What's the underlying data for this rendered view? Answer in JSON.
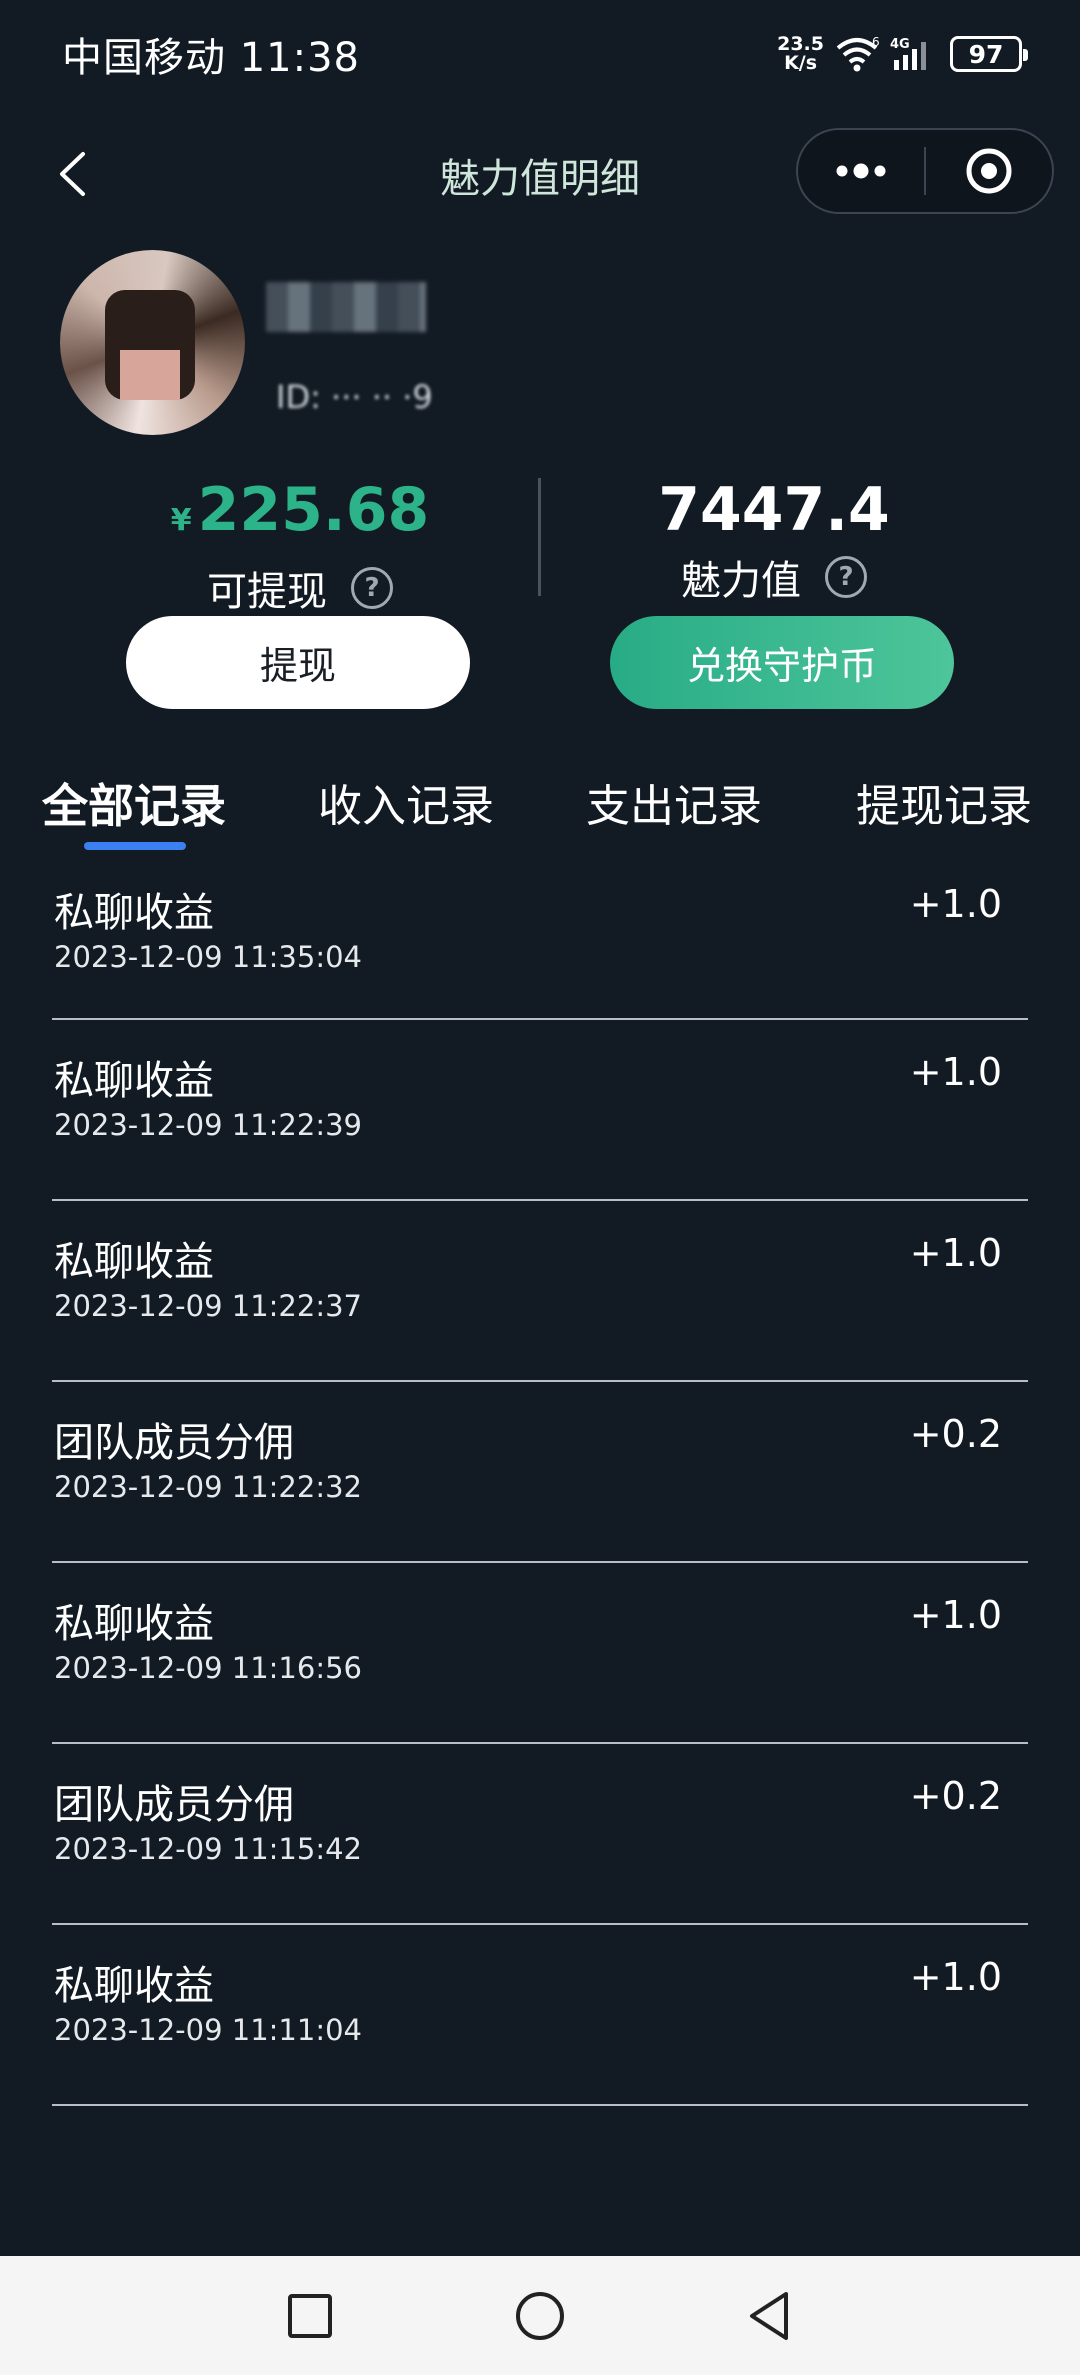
{
  "status_bar": {
    "carrier_time": "中国移动 11:38",
    "net_speed_value": "23.5",
    "net_speed_unit": "K/s",
    "wifi_label": "6",
    "signal_label": "4G",
    "battery": "97"
  },
  "nav": {
    "title": "魅力值明细"
  },
  "profile": {
    "id_label": "ID: ··· ·· ·9"
  },
  "stats": {
    "withdrawable_currency": "¥",
    "withdrawable_value": "225.68",
    "withdrawable_label": "可提现",
    "charm_value": "7447.4",
    "charm_label": "魅力值",
    "help_glyph": "?"
  },
  "buttons": {
    "withdraw": "提现",
    "exchange": "兑换守护币"
  },
  "tabs": [
    {
      "label": "全部记录",
      "active": true
    },
    {
      "label": "收入记录",
      "active": false
    },
    {
      "label": "支出记录",
      "active": false
    },
    {
      "label": "提现记录",
      "active": false
    }
  ],
  "records": [
    {
      "title": "私聊收益",
      "time": "2023-12-09 11:35:04",
      "amount": "+1.0"
    },
    {
      "title": "私聊收益",
      "time": "2023-12-09 11:22:39",
      "amount": "+1.0"
    },
    {
      "title": "私聊收益",
      "time": "2023-12-09 11:22:37",
      "amount": "+1.0"
    },
    {
      "title": "团队成员分佣",
      "time": "2023-12-09 11:22:32",
      "amount": "+0.2"
    },
    {
      "title": "私聊收益",
      "time": "2023-12-09 11:16:56",
      "amount": "+1.0"
    },
    {
      "title": "团队成员分佣",
      "time": "2023-12-09 11:15:42",
      "amount": "+0.2"
    },
    {
      "title": "私聊收益",
      "time": "2023-12-09 11:11:04",
      "amount": "+1.0"
    }
  ],
  "colors": {
    "background": "#121a23",
    "accent_green": "#2db389",
    "tab_indicator": "#3c7ff0"
  },
  "icons": {
    "back": "back-arrow-icon",
    "more": "more-dots-icon",
    "close": "target-circle-icon",
    "help": "question-circle-icon",
    "sys_recent": "square-icon",
    "sys_home": "circle-icon",
    "sys_back": "triangle-back-icon"
  }
}
